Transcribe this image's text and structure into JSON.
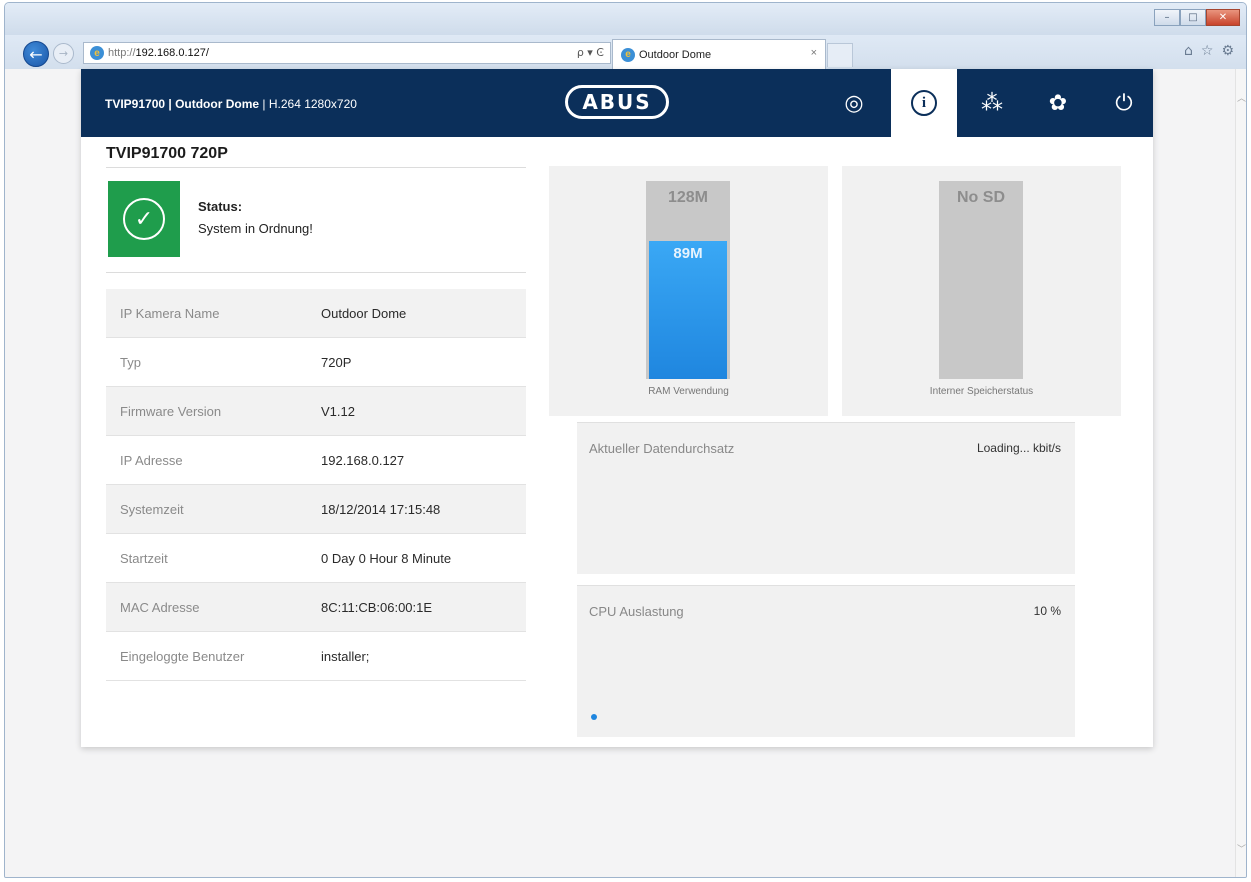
{
  "browser": {
    "url_protocol": "http://",
    "url_host": "192.168.0.127/",
    "address_tools": "ρ ▾ Ͼ",
    "tab_title": "Outdoor Dome",
    "tab_close": "×",
    "back_glyph": "←",
    "forward_glyph": "→",
    "home_icon": "⌂",
    "favorites_icon": "☆",
    "tools_icon": "⚙",
    "minimize_glyph": "–",
    "maximize_glyph": "□",
    "close_glyph": "✕"
  },
  "header": {
    "title_bold": "TVIP91700 | Outdoor Dome",
    "title_rest": " | H.264 1280x720",
    "logo": "ABUS",
    "icons": [
      "camera-lens-icon",
      "info-icon",
      "wizard-icon",
      "settings-icon",
      "power-icon"
    ],
    "info_glyph": "i",
    "camera_glyph": "◎",
    "wizard_glyph": "⁂",
    "settings_glyph": "✿",
    "power_glyph": "⏻"
  },
  "device": {
    "title": "TVIP91700 720P"
  },
  "status": {
    "label": "Status:",
    "text": "System in Ordnung!",
    "check_glyph": "✓",
    "color": "#1f9d4c"
  },
  "info": [
    {
      "key": "IP Kamera Name",
      "value": "Outdoor Dome"
    },
    {
      "key": "Typ",
      "value": "720P"
    },
    {
      "key": "Firmware Version",
      "value": "V1.12"
    },
    {
      "key": "IP Adresse",
      "value": "192.168.0.127"
    },
    {
      "key": "Systemzeit",
      "value": "18/12/2014 17:15:48"
    },
    {
      "key": "Startzeit",
      "value": "0 Day 0 Hour 8 Minute"
    },
    {
      "key": "MAC Adresse",
      "value": "8C:11:CB:06:00:1E"
    },
    {
      "key": "Eingeloggte Benutzer",
      "value": "installer;"
    }
  ],
  "ram": {
    "total": "128M",
    "used": "89M",
    "used_fraction": 0.695,
    "caption": "RAM Verwendung"
  },
  "storage": {
    "total": "No SD",
    "caption": "Interner Speicherstatus"
  },
  "throughput": {
    "label": "Aktueller Datendurchsatz",
    "value": "Loading... kbit/s"
  },
  "cpu": {
    "label": "CPU Auslastung",
    "value": "10 %"
  },
  "colors": {
    "header": "#0b2f5a",
    "accent": "#1f86df"
  }
}
